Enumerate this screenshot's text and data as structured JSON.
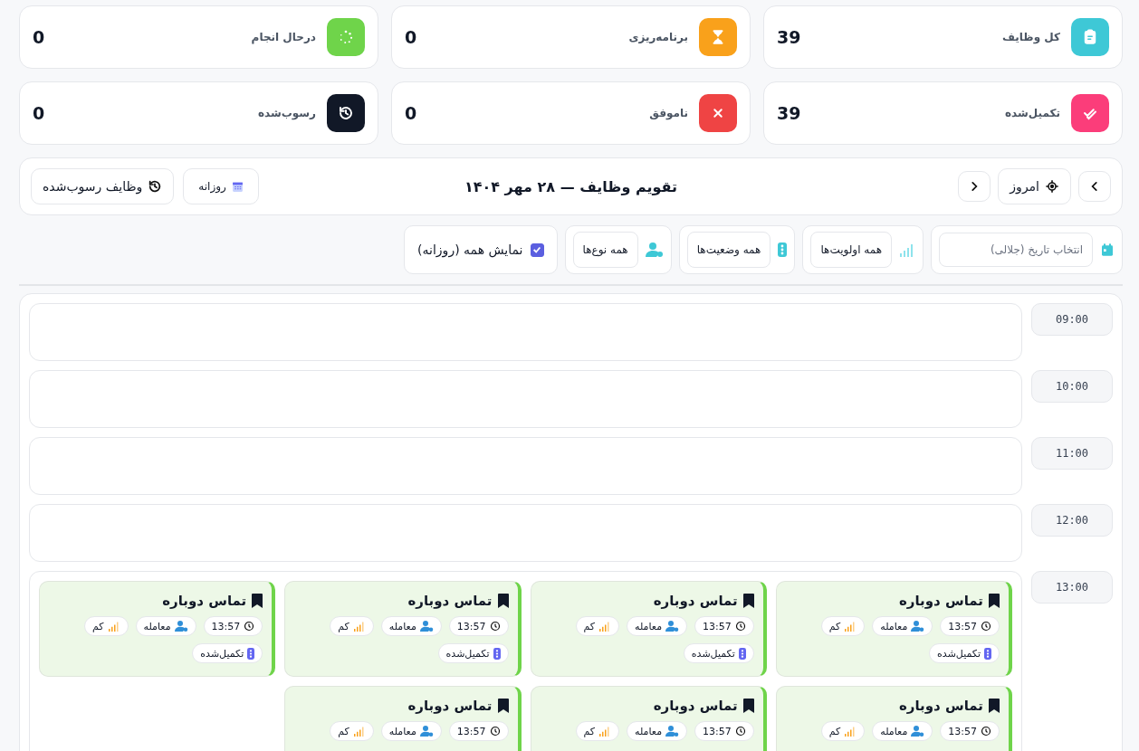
{
  "stats": [
    {
      "label": "کل وظایف",
      "value": "39",
      "color": "#3ec8d6",
      "kind": "clipboard"
    },
    {
      "label": "برنامه‌ریزی",
      "value": "0",
      "color": "#f9a11b",
      "kind": "hourglass"
    },
    {
      "label": "درحال انجام",
      "value": "0",
      "color": "#6fd44a",
      "kind": "spinner"
    },
    {
      "label": "تکمیل‌شده",
      "value": "39",
      "color": "#fb3d7a",
      "kind": "double-check"
    },
    {
      "label": "ناموفق",
      "value": "0",
      "color": "#ef4444",
      "kind": "cross"
    },
    {
      "label": "رسوب‌شده",
      "value": "0",
      "color": "#111827",
      "kind": "history"
    }
  ],
  "calendar_bar": {
    "today": "امروز",
    "title": "تقویم وظایف — ۲۸ مهر ۱۴۰۴",
    "view": "روزانه",
    "overdue_button": "وظایف رسوب‌شده"
  },
  "filters": {
    "date_placeholder": "انتخاب تاریخ (جلالی)",
    "priority": "همه اولویت‌ها",
    "status": "همه وضعیت‌ها",
    "type": "همه نوع‌ها",
    "show_all": {
      "label": "نمایش همه (روزانه)",
      "checked": true
    }
  },
  "slots": [
    {
      "time": "09:00"
    },
    {
      "time": "10:00"
    },
    {
      "time": "11:00"
    },
    {
      "time": "12:00"
    },
    {
      "time": "13:00",
      "tasks": [
        {
          "title": "تماس دوباره",
          "time": "13:57",
          "type": "معامله",
          "priority": "کم",
          "status": "تکمیل‌شده"
        },
        {
          "title": "تماس دوباره",
          "time": "13:57",
          "type": "معامله",
          "priority": "کم",
          "status": "تکمیل‌شده"
        },
        {
          "title": "تماس دوباره",
          "time": "13:57",
          "type": "معامله",
          "priority": "کم",
          "status": "تکمیل‌شده"
        },
        {
          "title": "تماس دوباره",
          "time": "13:57",
          "type": "معامله",
          "priority": "کم",
          "status": "تکمیل‌شده"
        },
        {
          "title": "تماس دوباره",
          "time": "13:57",
          "type": "معامله",
          "priority": "کم"
        },
        {
          "title": "تماس دوباره",
          "time": "13:57",
          "type": "معامله",
          "priority": "کم"
        },
        {
          "title": "تماس دوباره",
          "time": "13:57",
          "type": "معامله",
          "priority": "کم"
        }
      ]
    }
  ]
}
